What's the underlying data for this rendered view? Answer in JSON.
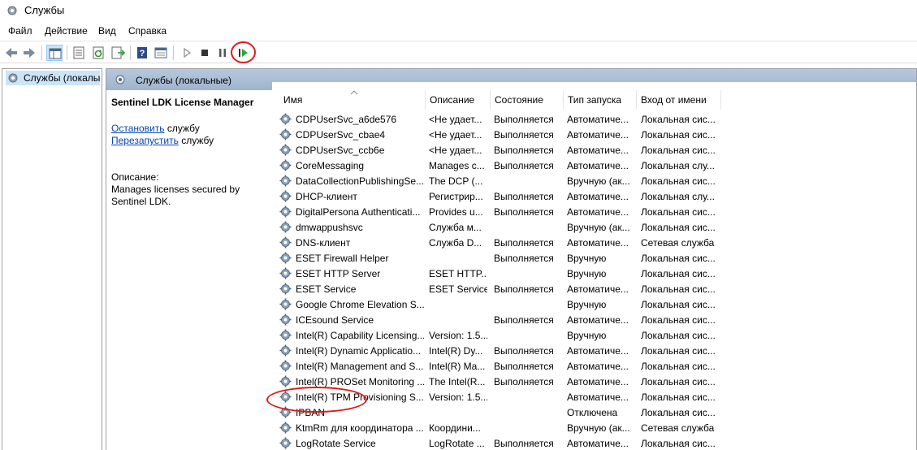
{
  "window": {
    "title": "Службы"
  },
  "menu": [
    "Файл",
    "Действие",
    "Вид",
    "Справка"
  ],
  "tree": {
    "root_label": "Службы (локалы"
  },
  "pane": {
    "header_title": "Службы (локальные)"
  },
  "details": {
    "service_name": "Sentinel LDK License Manager",
    "stop_link": "Остановить",
    "stop_suffix": " службу",
    "restart_link": "Перезапустить",
    "restart_suffix": " службу",
    "description_heading": "Описание:",
    "description": "Manages licenses secured by Sentinel LDK."
  },
  "columns": [
    "Имя",
    "Описание",
    "Состояние",
    "Тип запуска",
    "Вход от имени"
  ],
  "rows": [
    [
      "CDPUserSvc_a6de576",
      "<Не удает...",
      "Выполняется",
      "Автоматиче...",
      "Локальная сис..."
    ],
    [
      "CDPUserSvc_cbae4",
      "<Не удает...",
      "Выполняется",
      "Автоматиче...",
      "Локальная сис..."
    ],
    [
      "CDPUserSvc_ccb6e",
      "<Не удает...",
      "Выполняется",
      "Автоматиче...",
      "Локальная сис..."
    ],
    [
      "CoreMessaging",
      "Manages c...",
      "Выполняется",
      "Автоматиче...",
      "Локальная слу..."
    ],
    [
      "DataCollectionPublishingSe...",
      "The DCP (...",
      "",
      "Вручную (ак...",
      "Локальная сис..."
    ],
    [
      "DHCP-клиент",
      "Регистрир...",
      "Выполняется",
      "Автоматиче...",
      "Локальная слу..."
    ],
    [
      "DigitalPersona Authenticati...",
      "Provides u...",
      "Выполняется",
      "Автоматиче...",
      "Локальная сис..."
    ],
    [
      "dmwappushsvc",
      "Служба м...",
      "",
      "Вручную (ак...",
      "Локальная сис..."
    ],
    [
      "DNS-клиент",
      "Служба D...",
      "Выполняется",
      "Автоматиче...",
      "Сетевая служба"
    ],
    [
      "ESET Firewall Helper",
      "",
      "Выполняется",
      "Вручную",
      "Локальная сис..."
    ],
    [
      "ESET HTTP Server",
      "ESET HTTP...",
      "",
      "Вручную",
      "Локальная сис..."
    ],
    [
      "ESET Service",
      "ESET Service",
      "Выполняется",
      "Автоматиче...",
      "Локальная сис..."
    ],
    [
      "Google Chrome Elevation S...",
      "",
      "",
      "Вручную",
      "Локальная сис..."
    ],
    [
      "ICEsound Service",
      "",
      "Выполняется",
      "Автоматиче...",
      "Локальная сис..."
    ],
    [
      "Intel(R) Capability Licensing...",
      "Version: 1.5...",
      "",
      "Вручную",
      "Локальная сис..."
    ],
    [
      "Intel(R) Dynamic Applicatio...",
      "Intel(R) Dy...",
      "Выполняется",
      "Автоматиче...",
      "Локальная сис..."
    ],
    [
      "Intel(R) Management and S...",
      "Intel(R) Ma...",
      "Выполняется",
      "Автоматиче...",
      "Локальная сис..."
    ],
    [
      "Intel(R) PROSet Monitoring ...",
      "The Intel(R...",
      "Выполняется",
      "Автоматиче...",
      "Локальная сис..."
    ],
    [
      "Intel(R) TPM Provisioning S...",
      "Version: 1.5...",
      "",
      "Автоматиче...",
      "Локальная сис..."
    ],
    [
      "IPBAN",
      "",
      "",
      "Отключена",
      "Локальная сис..."
    ],
    [
      "KtmRm для координатора ...",
      "Координи...",
      "",
      "Вручную (ак...",
      "Сетевая служба"
    ],
    [
      "LogRotate Service",
      "LogRotate ...",
      "Выполняется",
      "Автоматиче...",
      "Локальная сис..."
    ]
  ],
  "toolbar_icons": [
    "back-arrow-icon",
    "forward-arrow-icon",
    "console-tree-icon",
    "properties-icon",
    "refresh-icon",
    "export-list-icon",
    "help-icon",
    "view-icon",
    "start-service-icon",
    "stop-service-icon",
    "pause-service-icon",
    "restart-service-icon"
  ],
  "colors": {
    "highlight_circle": "#e01b1b",
    "pane_header": "#b6c8dd",
    "selection": "#cce4f7",
    "link": "#0645ad"
  }
}
